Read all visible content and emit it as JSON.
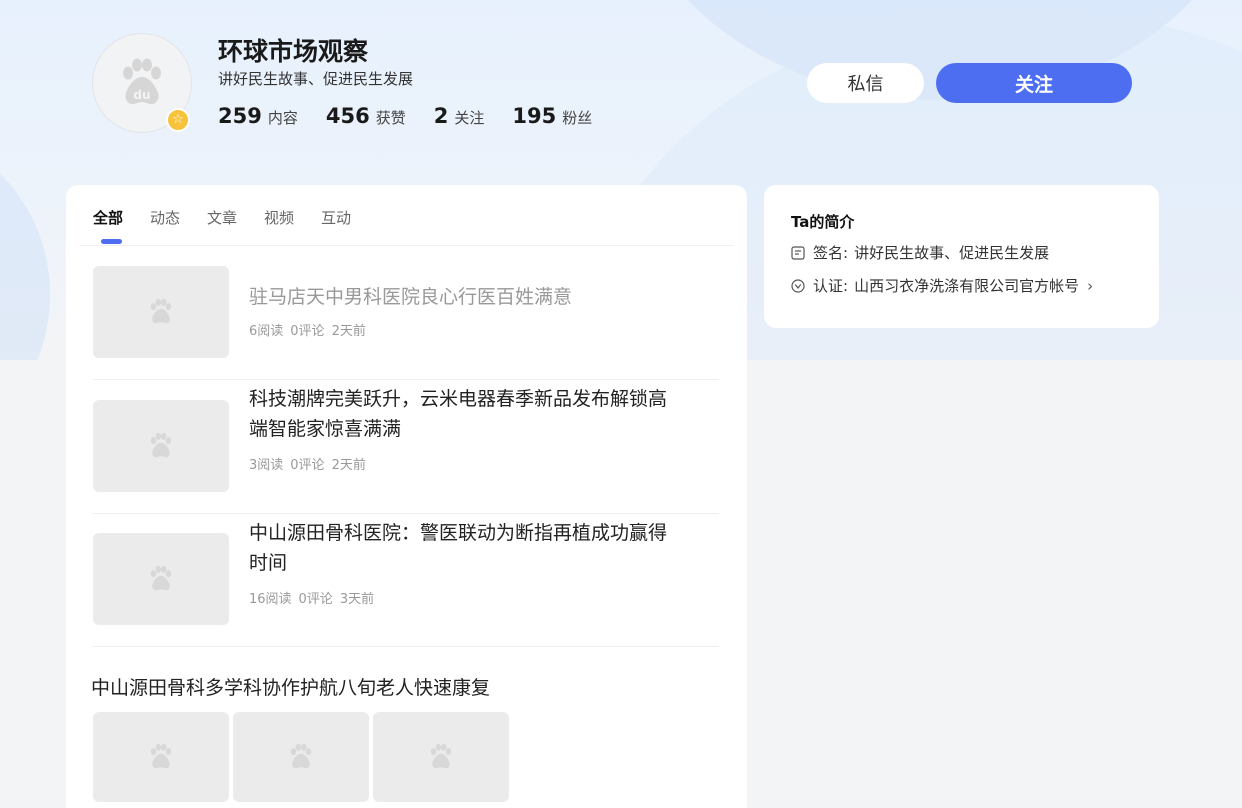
{
  "profile": {
    "name": "环球市场观察",
    "sign": "讲好民生故事、促进民生发展",
    "avatar_icon": "baidu-paw-icon",
    "badge_icon": "star-icon",
    "stats": [
      {
        "num": "259",
        "label": "内容"
      },
      {
        "num": "456",
        "label": "获赞"
      },
      {
        "num": "2",
        "label": "关注"
      },
      {
        "num": "195",
        "label": "粉丝"
      }
    ]
  },
  "actions": {
    "message_label": "私信",
    "follow_label": "关注"
  },
  "tabs": [
    {
      "label": "全部",
      "active": true
    },
    {
      "label": "动态",
      "active": false
    },
    {
      "label": "文章",
      "active": false
    },
    {
      "label": "视频",
      "active": false
    },
    {
      "label": "互动",
      "active": false
    }
  ],
  "feed": {
    "items": [
      {
        "title": "驻马店天中男科医院良心行医百姓满意",
        "reads": "6阅读",
        "comments": "0评论",
        "time": "2天前",
        "visited": true
      },
      {
        "title": "科技潮牌完美跃升，云米电器春季新品发布解锁高端智能家惊喜满满",
        "reads": "3阅读",
        "comments": "0评论",
        "time": "2天前",
        "visited": false
      },
      {
        "title": "中山源田骨科医院：警医联动为断指再植成功赢得时间",
        "reads": "16阅读",
        "comments": "0评论",
        "time": "3天前",
        "visited": false
      }
    ],
    "multi": {
      "title": "中山源田骨科多学科协作护航八旬老人快速康复"
    }
  },
  "intro": {
    "title": "Ta的简介",
    "sign_prefix": "签名:",
    "sign_value": "讲好民生故事、促进民生发展",
    "cert_prefix": "认证:",
    "cert_value": "山西习衣净洗涤有限公司官方帐号"
  },
  "colors": {
    "accent": "#4e6ef2",
    "badge": "#f6c33b"
  }
}
